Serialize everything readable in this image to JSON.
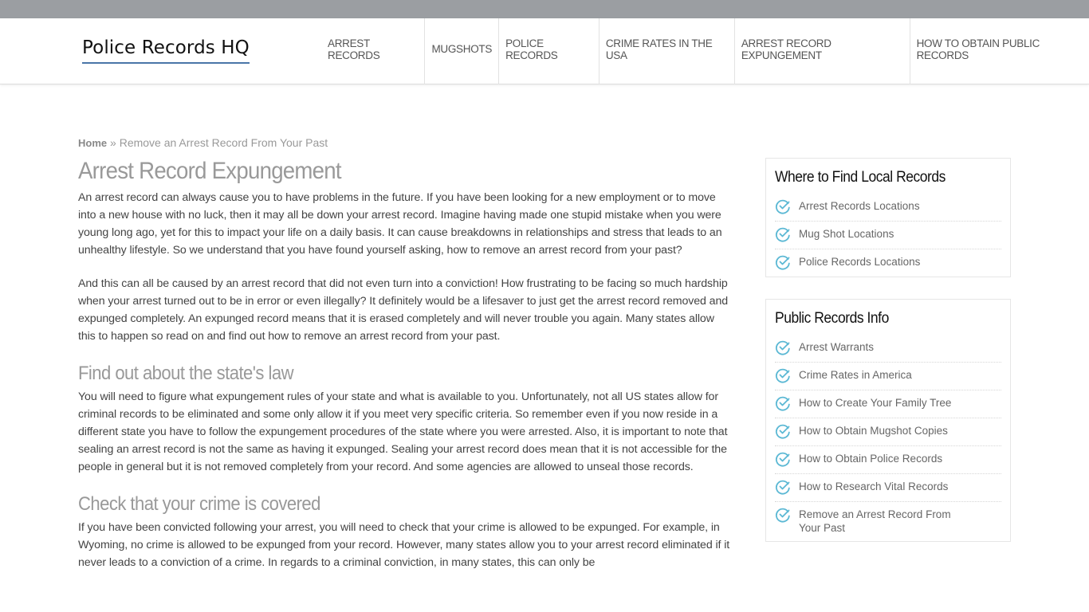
{
  "site": {
    "logo": "Police Records HQ",
    "accent_color": "#4a76a8",
    "check_color": "#5bb8d4"
  },
  "nav": {
    "items": [
      {
        "label": "Arrest Records"
      },
      {
        "label": "Mugshots"
      },
      {
        "label": "Police Records"
      },
      {
        "label": "Crime Rates in the USA"
      },
      {
        "label": "Arrest Record Expungement"
      },
      {
        "label": "How to Obtain Public Records"
      }
    ]
  },
  "breadcrumb": {
    "home": "Home",
    "separator": " » ",
    "current": "Remove an Arrest Record From Your Past"
  },
  "article": {
    "title": "Arrest Record Expungement",
    "paragraphs": [
      "An arrest record can always cause you to have problems in the future. If you have been looking for a new employment or to move into a new house with no luck, then it may all be down your arrest record. Imagine having made one stupid mistake when you were young long ago, yet for this to impact your life on a daily basis. It can cause breakdowns in relationships and stress that leads to an unhealthy lifestyle. So we understand that you have found yourself asking, how to remove an arrest record from your past?",
      "And this can all be caused by an arrest record that did not even turn into a conviction! How frustrating to be facing so much hardship when your arrest turned out to be in error or even illegally? It definitely would be a lifesaver to just get the arrest record removed and expunged completely. An expunged record means that it is erased completely and will never trouble you again. Many states allow this to happen so read on and find out how to remove an arrest record from your past."
    ],
    "sections": [
      {
        "heading": "Find out about the state's law",
        "text": "You will need to figure what expungement rules of your state and what is available to you. Unfortunately, not all US states allow for criminal records to be eliminated and some only allow it if you meet very specific criteria. So remember even if you now reside in a different state you have to follow the expungement procedures of the state where you were arrested. Also, it is important to note that sealing an arrest record is not the same as having it expunged. Sealing your arrest record does mean that it is not accessible for the people in general but it is not removed completely from your record. And some agencies are allowed to unseal those records."
      },
      {
        "heading": "Check that your crime is covered",
        "text": "If you have been convicted following your arrest, you will need to check that your crime is allowed to be expunged. For example, in Wyoming, no crime is allowed to be expunged from your record. However, many states allow you to your arrest record eliminated if it never leads to a conviction of a crime. In regards to a criminal conviction, in many states, this can only be"
      }
    ]
  },
  "sidebar": {
    "widgets": [
      {
        "title": "Where to Find Local Records",
        "items": [
          {
            "label": "Arrest Records Locations",
            "icon": "check-circle-icon"
          },
          {
            "label": "Mug Shot Locations",
            "icon": "check-circle-icon"
          },
          {
            "label": "Police Records Locations",
            "icon": "check-circle-icon"
          }
        ]
      },
      {
        "title": "Public Records Info",
        "items": [
          {
            "label": "Arrest Warrants",
            "icon": "check-circle-icon"
          },
          {
            "label": "Crime Rates in America",
            "icon": "check-circle-icon"
          },
          {
            "label": "How to Create Your Family Tree",
            "icon": "check-circle-icon"
          },
          {
            "label": "How to Obtain Mugshot Copies",
            "icon": "check-circle-icon"
          },
          {
            "label": "How to Obtain Police Records",
            "icon": "check-circle-icon"
          },
          {
            "label": "How to Research Vital Records",
            "icon": "check-circle-icon"
          },
          {
            "label": "Remove an Arrest Record From Your Past",
            "icon": "check-circle-icon"
          }
        ]
      }
    ]
  }
}
